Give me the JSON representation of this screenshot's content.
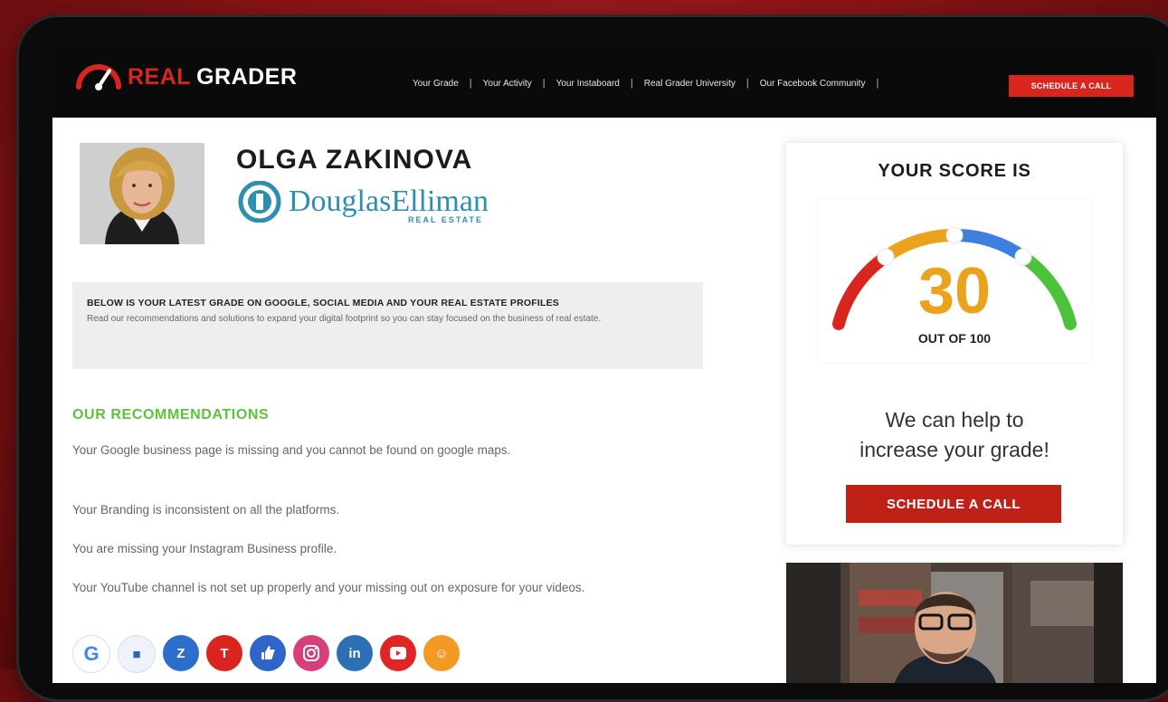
{
  "brand": {
    "real": "REAL",
    "grader": "GRADER"
  },
  "nav": {
    "items": [
      "Your Grade",
      "Your Activity",
      "Your Instaboard",
      "Real Grader University",
      "Our Facebook Community"
    ],
    "separator": "|",
    "cta": "SCHEDULE A CALL"
  },
  "profile": {
    "name": "OLGA ZAKINOVA",
    "brokerage": "DouglasElliman",
    "brokerage_sub": "REAL ESTATE"
  },
  "intro": {
    "heading": "BELOW IS YOUR LATEST GRADE ON GOOGLE, SOCIAL MEDIA AND YOUR REAL ESTATE PROFILES",
    "body": "Read our recommendations and solutions to expand your digital footprint so you can stay focused on the business of real estate."
  },
  "recommendations": {
    "title": "OUR RECOMMENDATIONS",
    "items": [
      "Your Google business page is missing and you cannot be found on google maps.",
      "Your Branding is inconsistent on all the platforms.",
      "You are missing your Instagram Business profile.",
      "Your YouTube channel is not set up properly and your missing out on exposure for your videos."
    ]
  },
  "social_icons": [
    {
      "name": "google-icon",
      "glyph": "G",
      "color": "#ffffff"
    },
    {
      "name": "realtor-icon",
      "glyph": "■",
      "color": "#eef2fb"
    },
    {
      "name": "zillow-icon",
      "glyph": "Z",
      "color": "#2c6ecb"
    },
    {
      "name": "trulia-icon",
      "glyph": "T",
      "color": "#d8261e"
    },
    {
      "name": "facebook-like-icon",
      "glyph": "👍",
      "color": "#2f64c8"
    },
    {
      "name": "instagram-icon",
      "glyph": "◎",
      "color": "#d6407a"
    },
    {
      "name": "linkedin-icon",
      "glyph": "in",
      "color": "#2d6fb5"
    },
    {
      "name": "youtube-icon",
      "glyph": "▶",
      "color": "#e12424"
    },
    {
      "name": "other-icon",
      "glyph": "☺",
      "color": "#f29a24"
    }
  ],
  "score": {
    "title": "YOUR SCORE IS",
    "value": "30",
    "out_of": "OUT OF 100",
    "help_line1": "We can help to",
    "help_line2": "increase your grade!",
    "cta": "SCHEDULE A CALL",
    "gauge_colors": [
      "#d8261e",
      "#eba31e",
      "#3f7fe0",
      "#4cc23a"
    ]
  },
  "colors": {
    "accent_red": "#d8261e",
    "rec_green": "#5cc43a",
    "score_orange": "#eba31e"
  }
}
